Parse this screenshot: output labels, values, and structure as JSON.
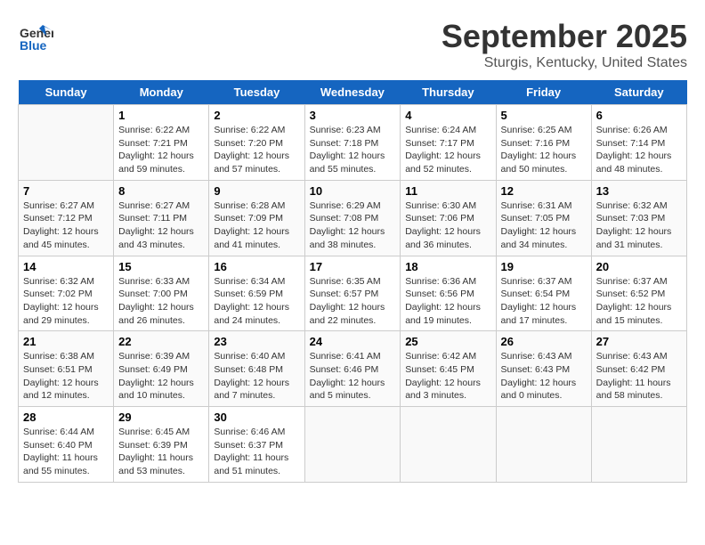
{
  "header": {
    "logo_general": "General",
    "logo_blue": "Blue",
    "month": "September 2025",
    "location": "Sturgis, Kentucky, United States"
  },
  "days": [
    "Sunday",
    "Monday",
    "Tuesday",
    "Wednesday",
    "Thursday",
    "Friday",
    "Saturday"
  ],
  "weeks": [
    [
      {
        "date": "",
        "info": ""
      },
      {
        "date": "1",
        "info": "Sunrise: 6:22 AM\nSunset: 7:21 PM\nDaylight: 12 hours\nand 59 minutes."
      },
      {
        "date": "2",
        "info": "Sunrise: 6:22 AM\nSunset: 7:20 PM\nDaylight: 12 hours\nand 57 minutes."
      },
      {
        "date": "3",
        "info": "Sunrise: 6:23 AM\nSunset: 7:18 PM\nDaylight: 12 hours\nand 55 minutes."
      },
      {
        "date": "4",
        "info": "Sunrise: 6:24 AM\nSunset: 7:17 PM\nDaylight: 12 hours\nand 52 minutes."
      },
      {
        "date": "5",
        "info": "Sunrise: 6:25 AM\nSunset: 7:16 PM\nDaylight: 12 hours\nand 50 minutes."
      },
      {
        "date": "6",
        "info": "Sunrise: 6:26 AM\nSunset: 7:14 PM\nDaylight: 12 hours\nand 48 minutes."
      }
    ],
    [
      {
        "date": "7",
        "info": "Sunrise: 6:27 AM\nSunset: 7:12 PM\nDaylight: 12 hours\nand 45 minutes."
      },
      {
        "date": "8",
        "info": "Sunrise: 6:27 AM\nSunset: 7:11 PM\nDaylight: 12 hours\nand 43 minutes."
      },
      {
        "date": "9",
        "info": "Sunrise: 6:28 AM\nSunset: 7:09 PM\nDaylight: 12 hours\nand 41 minutes."
      },
      {
        "date": "10",
        "info": "Sunrise: 6:29 AM\nSunset: 7:08 PM\nDaylight: 12 hours\nand 38 minutes."
      },
      {
        "date": "11",
        "info": "Sunrise: 6:30 AM\nSunset: 7:06 PM\nDaylight: 12 hours\nand 36 minutes."
      },
      {
        "date": "12",
        "info": "Sunrise: 6:31 AM\nSunset: 7:05 PM\nDaylight: 12 hours\nand 34 minutes."
      },
      {
        "date": "13",
        "info": "Sunrise: 6:32 AM\nSunset: 7:03 PM\nDaylight: 12 hours\nand 31 minutes."
      }
    ],
    [
      {
        "date": "14",
        "info": "Sunrise: 6:32 AM\nSunset: 7:02 PM\nDaylight: 12 hours\nand 29 minutes."
      },
      {
        "date": "15",
        "info": "Sunrise: 6:33 AM\nSunset: 7:00 PM\nDaylight: 12 hours\nand 26 minutes."
      },
      {
        "date": "16",
        "info": "Sunrise: 6:34 AM\nSunset: 6:59 PM\nDaylight: 12 hours\nand 24 minutes."
      },
      {
        "date": "17",
        "info": "Sunrise: 6:35 AM\nSunset: 6:57 PM\nDaylight: 12 hours\nand 22 minutes."
      },
      {
        "date": "18",
        "info": "Sunrise: 6:36 AM\nSunset: 6:56 PM\nDaylight: 12 hours\nand 19 minutes."
      },
      {
        "date": "19",
        "info": "Sunrise: 6:37 AM\nSunset: 6:54 PM\nDaylight: 12 hours\nand 17 minutes."
      },
      {
        "date": "20",
        "info": "Sunrise: 6:37 AM\nSunset: 6:52 PM\nDaylight: 12 hours\nand 15 minutes."
      }
    ],
    [
      {
        "date": "21",
        "info": "Sunrise: 6:38 AM\nSunset: 6:51 PM\nDaylight: 12 hours\nand 12 minutes."
      },
      {
        "date": "22",
        "info": "Sunrise: 6:39 AM\nSunset: 6:49 PM\nDaylight: 12 hours\nand 10 minutes."
      },
      {
        "date": "23",
        "info": "Sunrise: 6:40 AM\nSunset: 6:48 PM\nDaylight: 12 hours\nand 7 minutes."
      },
      {
        "date": "24",
        "info": "Sunrise: 6:41 AM\nSunset: 6:46 PM\nDaylight: 12 hours\nand 5 minutes."
      },
      {
        "date": "25",
        "info": "Sunrise: 6:42 AM\nSunset: 6:45 PM\nDaylight: 12 hours\nand 3 minutes."
      },
      {
        "date": "26",
        "info": "Sunrise: 6:43 AM\nSunset: 6:43 PM\nDaylight: 12 hours\nand 0 minutes."
      },
      {
        "date": "27",
        "info": "Sunrise: 6:43 AM\nSunset: 6:42 PM\nDaylight: 11 hours\nand 58 minutes."
      }
    ],
    [
      {
        "date": "28",
        "info": "Sunrise: 6:44 AM\nSunset: 6:40 PM\nDaylight: 11 hours\nand 55 minutes."
      },
      {
        "date": "29",
        "info": "Sunrise: 6:45 AM\nSunset: 6:39 PM\nDaylight: 11 hours\nand 53 minutes."
      },
      {
        "date": "30",
        "info": "Sunrise: 6:46 AM\nSunset: 6:37 PM\nDaylight: 11 hours\nand 51 minutes."
      },
      {
        "date": "",
        "info": ""
      },
      {
        "date": "",
        "info": ""
      },
      {
        "date": "",
        "info": ""
      },
      {
        "date": "",
        "info": ""
      }
    ]
  ]
}
